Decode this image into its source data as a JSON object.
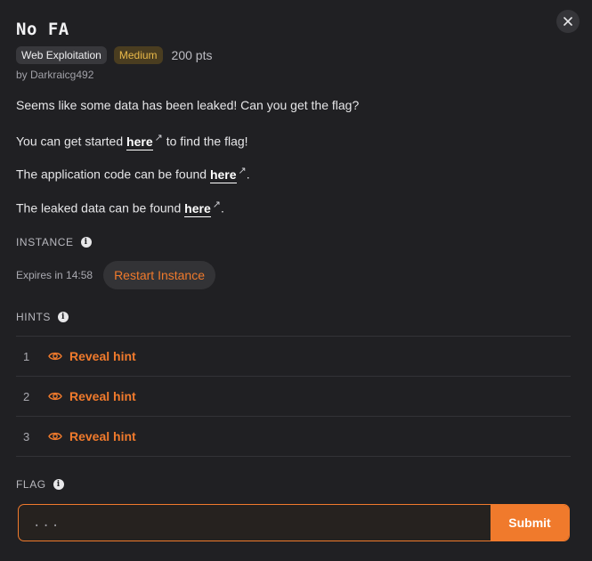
{
  "challenge": {
    "title": "No FA",
    "category": "Web Exploitation",
    "difficulty": "Medium",
    "points": "200 pts",
    "author": "by Darkraicg492"
  },
  "description": {
    "p1": "Seems like some data has been leaked! Can you get the flag?",
    "p2_pre": "You can get started",
    "p2_link": "here",
    "p2_post": "to find the flag!",
    "p3_pre": "The application code can be found",
    "p3_link": "here",
    "p3_post": ".",
    "p4_pre": "The leaked data can be found",
    "p4_link": "here",
    "p4_post": "."
  },
  "instance": {
    "label": "INSTANCE",
    "expires": "Expires in 14:58",
    "restart_label": "Restart Instance"
  },
  "hints": {
    "label": "HINTS",
    "items": [
      {
        "num": "1",
        "label": "Reveal hint"
      },
      {
        "num": "2",
        "label": "Reveal hint"
      },
      {
        "num": "3",
        "label": "Reveal hint"
      }
    ]
  },
  "flag": {
    "label": "FLAG",
    "placeholder": "...",
    "value": "",
    "submit_label": "Submit"
  },
  "colors": {
    "accent": "#f07a2c",
    "background": "#202023",
    "difficulty": "#e9b949"
  },
  "icons": {
    "close": "close-icon",
    "info": "info-icon",
    "external": "external-link-icon",
    "eye": "eye-icon"
  }
}
